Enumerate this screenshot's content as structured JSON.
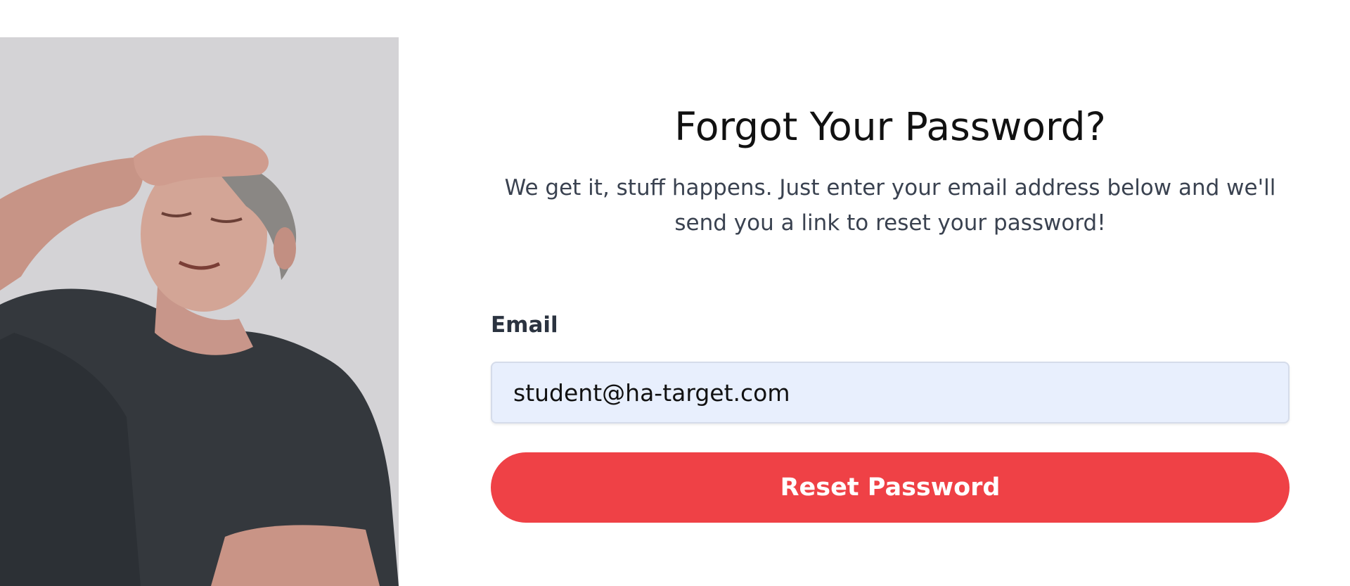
{
  "form": {
    "title": "Forgot Your Password?",
    "subtitle_line1": "We get it, stuff happens. Just enter your email address below and we'll",
    "subtitle_line2": "send you a link to reset your password!",
    "email_label": "Email",
    "email_value": "student@ha-target.com",
    "submit_label": "Reset Password"
  },
  "colors": {
    "accent": "#ef4146",
    "input_background": "#e8effd"
  },
  "image": {
    "subject": "frustrated-man-facepalm-photo"
  }
}
